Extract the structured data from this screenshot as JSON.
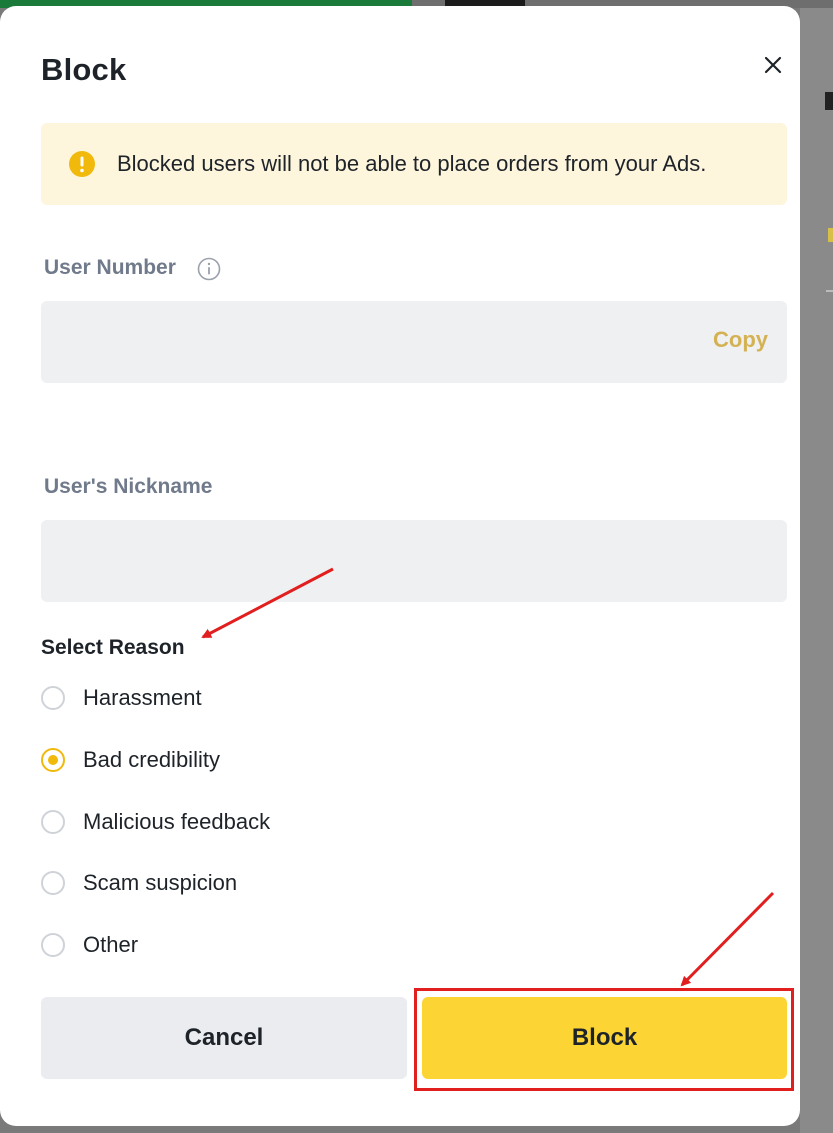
{
  "dialog": {
    "title": "Block",
    "notice": "Blocked users will not be able to place orders from your Ads."
  },
  "user_number": {
    "label": "User Number",
    "value": "",
    "copy_label": "Copy"
  },
  "nickname": {
    "label": "User's Nickname",
    "value": ""
  },
  "reason": {
    "title": "Select Reason",
    "options": [
      "Harassment",
      "Bad credibility",
      "Malicious feedback",
      "Scam suspicion",
      "Other"
    ],
    "selected": "Bad credibility"
  },
  "actions": {
    "cancel_label": "Cancel",
    "block_label": "Block"
  },
  "colors": {
    "accent": "#FCD535",
    "radio_selected": "#F0B90B",
    "copy_text": "#D4B254",
    "notice_bg": "#FDF6DC",
    "annotation": "#E21F1F"
  },
  "icons": [
    "close-icon",
    "warning-icon",
    "info-icon"
  ]
}
